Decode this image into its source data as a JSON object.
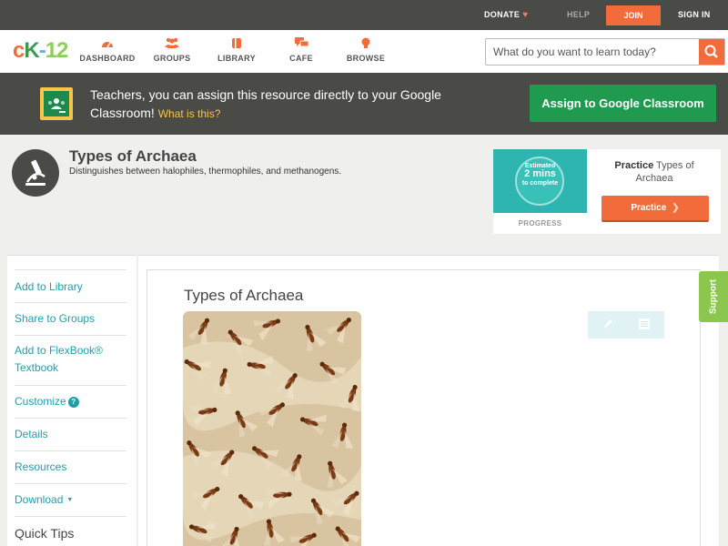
{
  "topbar": {
    "donate": "DONATE",
    "help": "HELP",
    "join": "JOIN",
    "signin": "SIGN IN"
  },
  "logo": {
    "text": "CK-12"
  },
  "nav": {
    "items": [
      {
        "label": "DASHBOARD",
        "icon": "dashboard-icon"
      },
      {
        "label": "GROUPS",
        "icon": "groups-icon"
      },
      {
        "label": "LIBRARY",
        "icon": "library-icon"
      },
      {
        "label": "CAFE",
        "icon": "cafe-icon"
      },
      {
        "label": "BROWSE",
        "icon": "browse-icon"
      }
    ],
    "search_placeholder": "What do you want to learn today?"
  },
  "banner": {
    "message": "Teachers, you can assign this resource directly to your Google Classroom!",
    "what_is_this": "What is this?",
    "assign_button": "Assign to Google Classroom"
  },
  "concept": {
    "title": "Types of Archaea",
    "description": "Distinguishes between halophiles, thermophiles, and methanogens."
  },
  "practice_card": {
    "estimated_label": "Estimated",
    "estimated_value": "2 mins",
    "estimated_suffix": "to complete",
    "progress_label": "PROGRESS",
    "title_prefix": "Practice",
    "title_rest": "Types of Archaea",
    "button": "Practice"
  },
  "sidebar": {
    "items": [
      "Add to Library",
      "Share to Groups",
      "Add to FlexBook® Textbook",
      "Customize",
      "Details",
      "Resources",
      "Download"
    ],
    "quick_tips": "Quick Tips"
  },
  "main": {
    "lesson_title": "Types of Archaea"
  },
  "support": "Support",
  "colors": {
    "accent": "#f26b3a",
    "teal": "#1f9fa8",
    "green": "#1f9a4f",
    "dark_bar": "#4a4a47"
  }
}
